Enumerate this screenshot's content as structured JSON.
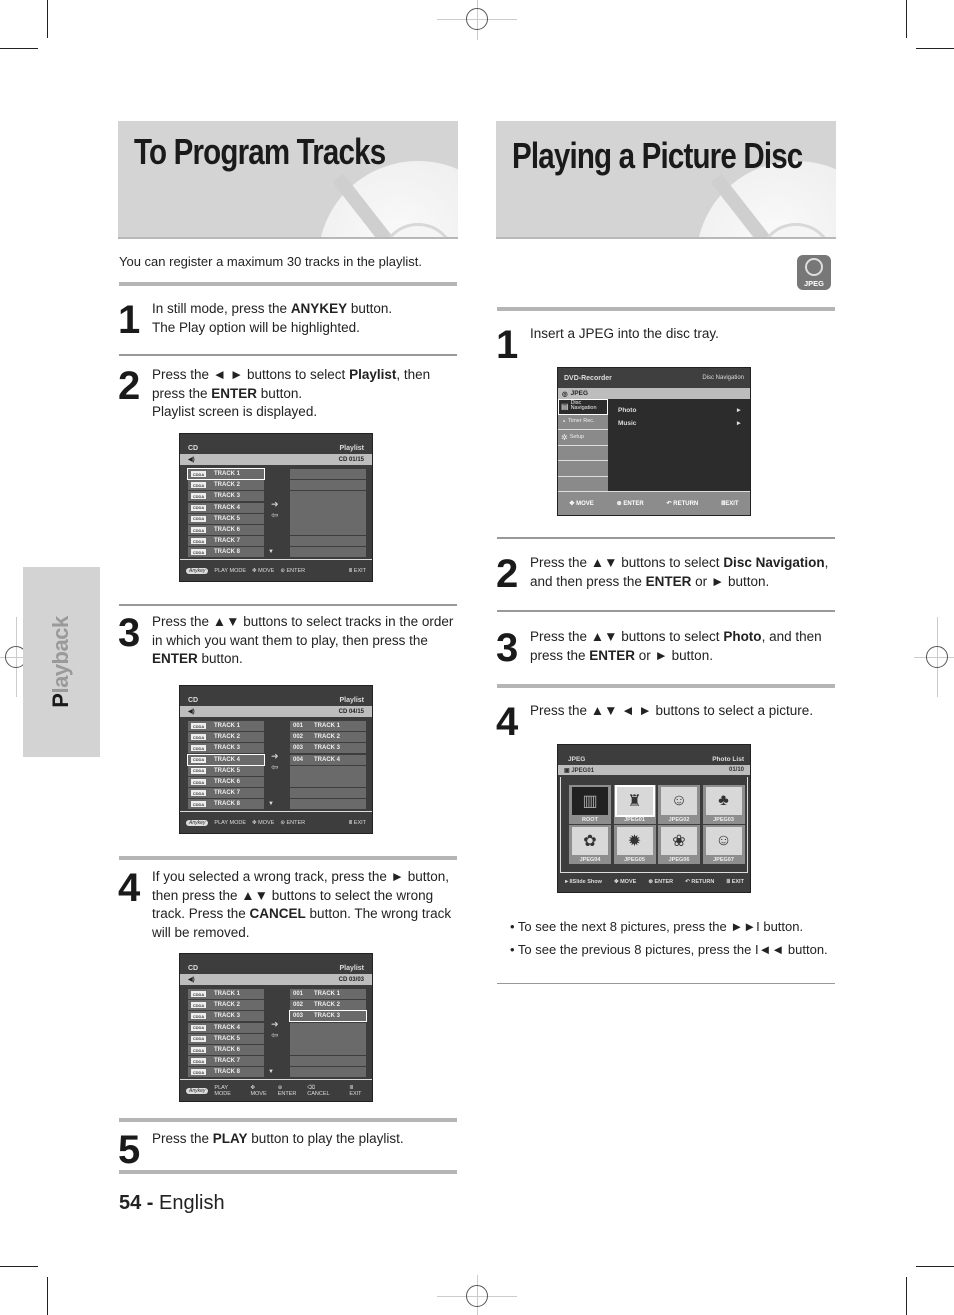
{
  "left": {
    "title": "To Program Tracks",
    "intro": "You can register a maximum 30 tracks in the playlist.",
    "steps": [
      {
        "num": "1",
        "html_parts": [
          "In still mode, press the ",
          "ANYKEY",
          " button.",
          "The Play option will be highlighted."
        ]
      },
      {
        "num": "2",
        "html_parts": [
          "Press the ◄ ► buttons to select ",
          "Playlist",
          ", then press the ",
          "ENTER",
          " button.",
          "Playlist screen is displayed."
        ]
      },
      {
        "num": "3",
        "html_parts": [
          "Press the ▲▼ buttons to select tracks in the order in which you want them to play, then press the ",
          "ENTER",
          " button."
        ]
      },
      {
        "num": "4",
        "html_parts": [
          "If you selected a wrong track, press the ► button, then press the ▲▼ buttons to select the wrong track. Press the ",
          "CANCEL",
          " button. The wrong track will be removed."
        ]
      },
      {
        "num": "5",
        "html_parts": [
          "Press the ",
          "PLAY",
          " button to play the playlist."
        ]
      }
    ],
    "screens": [
      {
        "source": "CD",
        "mode": "Playlist",
        "counter": "01/15",
        "selected_track": 0,
        "playlist": [],
        "selected_pl": -1,
        "footer": [
          "Anykey",
          "PLAY MODE",
          "MOVE",
          "ENTER",
          "",
          "EXIT"
        ]
      },
      {
        "source": "CD",
        "mode": "Playlist",
        "counter": "04/15",
        "selected_track": 3,
        "playlist": [
          {
            "n": "001",
            "t": "TRACK 1"
          },
          {
            "n": "002",
            "t": "TRACK 2"
          },
          {
            "n": "003",
            "t": "TRACK 3"
          },
          {
            "n": "004",
            "t": "TRACK 4"
          }
        ],
        "selected_pl": -1,
        "footer": [
          "Anykey",
          "PLAY MODE",
          "MOVE",
          "ENTER",
          "",
          "EXIT"
        ]
      },
      {
        "source": "CD",
        "mode": "Playlist",
        "counter": "03/03",
        "selected_track": -1,
        "playlist": [
          {
            "n": "001",
            "t": "TRACK 1"
          },
          {
            "n": "002",
            "t": "TRACK 2"
          },
          {
            "n": "003",
            "t": "TRACK 3"
          }
        ],
        "selected_pl": 2,
        "footer": [
          "Anykey",
          "PLAY MODE",
          "MOVE",
          "ENTER",
          "CANCEL",
          "EXIT"
        ]
      }
    ],
    "tracks": [
      "TRACK 1",
      "TRACK 2",
      "TRACK 3",
      "TRACK 4",
      "TRACK 5",
      "TRACK 6",
      "TRACK 7",
      "TRACK 8"
    ],
    "cdda_label": "CDDA"
  },
  "right": {
    "title": "Playing a Picture Disc",
    "badge": "JPEG",
    "steps": [
      {
        "num": "1",
        "html_parts": [
          "Insert a JPEG into the disc tray."
        ]
      },
      {
        "num": "2",
        "html_parts": [
          "Press the ▲▼ buttons to select ",
          "Disc Navigation",
          ", and then press the ",
          "ENTER",
          " or ► button."
        ]
      },
      {
        "num": "3",
        "html_parts": [
          "Press the ▲▼ buttons to select ",
          "Photo",
          ", and then press the ",
          "ENTER",
          " or ► button."
        ]
      },
      {
        "num": "4",
        "html_parts": [
          "Press the ▲▼ ◄ ► buttons to select a picture."
        ]
      }
    ],
    "disc_nav": {
      "header_left": "DVD-Recorder",
      "header_right": "Disc Navigation",
      "disc": "JPEG",
      "menu": [
        "Disc Navigation",
        "Timer Rec.",
        "Setup",
        "",
        "",
        ""
      ],
      "options": [
        "Photo",
        "Music"
      ],
      "footer": [
        "MOVE",
        "ENTER",
        "RETURN",
        "EXIT"
      ]
    },
    "photo_list": {
      "header_left": "JPEG",
      "header_right": "Photo List",
      "current": "JPEG01",
      "counter": "01/10",
      "thumbs": [
        "ROOT",
        "JPEG01",
        "JPEG02",
        "JPEG03",
        "JPEG04",
        "JPEG05",
        "JPEG06",
        "JPEG07"
      ],
      "selected": 1,
      "footer": [
        "Slide Show",
        "MOVE",
        "ENTER",
        "RETURN",
        "EXIT"
      ]
    },
    "bullets": [
      "• To see the next 8 pictures, press the ►►I button.",
      "• To see the previous 8 pictures, press the I◄◄ button."
    ]
  },
  "side_tab": {
    "first": "P",
    "rest": "layback"
  },
  "footer": {
    "page": "54 -",
    "lang": " English"
  }
}
